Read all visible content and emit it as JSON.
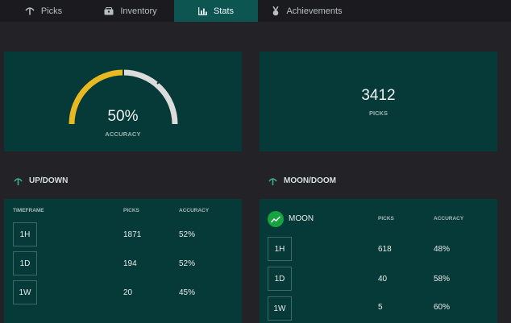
{
  "nav": {
    "tabs": [
      {
        "label": "Picks",
        "icon": "pickaxe-icon"
      },
      {
        "label": "Inventory",
        "icon": "chest-icon"
      },
      {
        "label": "Stats",
        "icon": "bar-chart-icon",
        "active": true
      },
      {
        "label": "Achievements",
        "icon": "medal-icon"
      }
    ]
  },
  "accuracy_card": {
    "value": "50%",
    "label": "ACCURACY",
    "gauge_fraction": 0.5,
    "colors": {
      "filled": "#e8b921",
      "track": "#dcdcdc"
    }
  },
  "picks_card": {
    "value": "3412",
    "label": "PICKS"
  },
  "updown": {
    "title": "UP/DOWN",
    "icon": "pickaxe-icon",
    "headers": {
      "timeframe": "TIMEFRAME",
      "picks": "PICKS",
      "accuracy": "ACCURACY"
    },
    "rows": [
      {
        "timeframe": "1H",
        "picks": "1871",
        "accuracy": "52%"
      },
      {
        "timeframe": "1D",
        "picks": "194",
        "accuracy": "52%"
      },
      {
        "timeframe": "1W",
        "picks": "20",
        "accuracy": "45%"
      }
    ]
  },
  "moondoom": {
    "title": "MOON/DOOM",
    "icon": "pickaxe-icon",
    "subtitle": "MOON",
    "subtitle_icon": "trending-up-icon",
    "headers": {
      "picks": "PICKS",
      "accuracy": "ACCURACY"
    },
    "rows": [
      {
        "timeframe": "1H",
        "picks": "618",
        "accuracy": "48%"
      },
      {
        "timeframe": "1D",
        "picks": "40",
        "accuracy": "58%"
      },
      {
        "timeframe": "1W",
        "picks": "5",
        "accuracy": "60%"
      }
    ]
  },
  "colors": {
    "background": "#232327",
    "nav": "#1b1b1f",
    "active_tab": "#0c5551",
    "card": "#063a38",
    "accent_green": "#17a33f",
    "gauge_yellow": "#e8b921"
  }
}
